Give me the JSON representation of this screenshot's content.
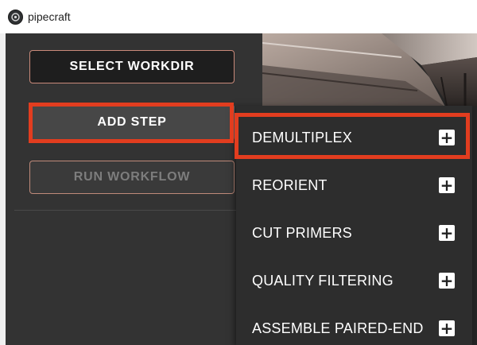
{
  "window": {
    "title": "pipecraft",
    "icon": "pipecraft-logo-icon"
  },
  "sidebar": {
    "select_workdir_label": "SELECT WORKDIR",
    "add_step_label": "ADD STEP",
    "run_workflow_label": "RUN WORKFLOW"
  },
  "menu": {
    "items": [
      {
        "label": "DEMULTIPLEX",
        "icon": "plus-icon"
      },
      {
        "label": "REORIENT",
        "icon": "plus-icon"
      },
      {
        "label": "CUT PRIMERS",
        "icon": "plus-icon"
      },
      {
        "label": "QUALITY FILTERING",
        "icon": "plus-icon"
      },
      {
        "label": "ASSEMBLE PAIRED-END",
        "icon": "plus-icon"
      }
    ]
  },
  "colors": {
    "highlight": "#e23d1f",
    "sidebar_bg": "#333333",
    "menu_bg": "#2d2d2d",
    "button_border": "#c98a7a"
  }
}
